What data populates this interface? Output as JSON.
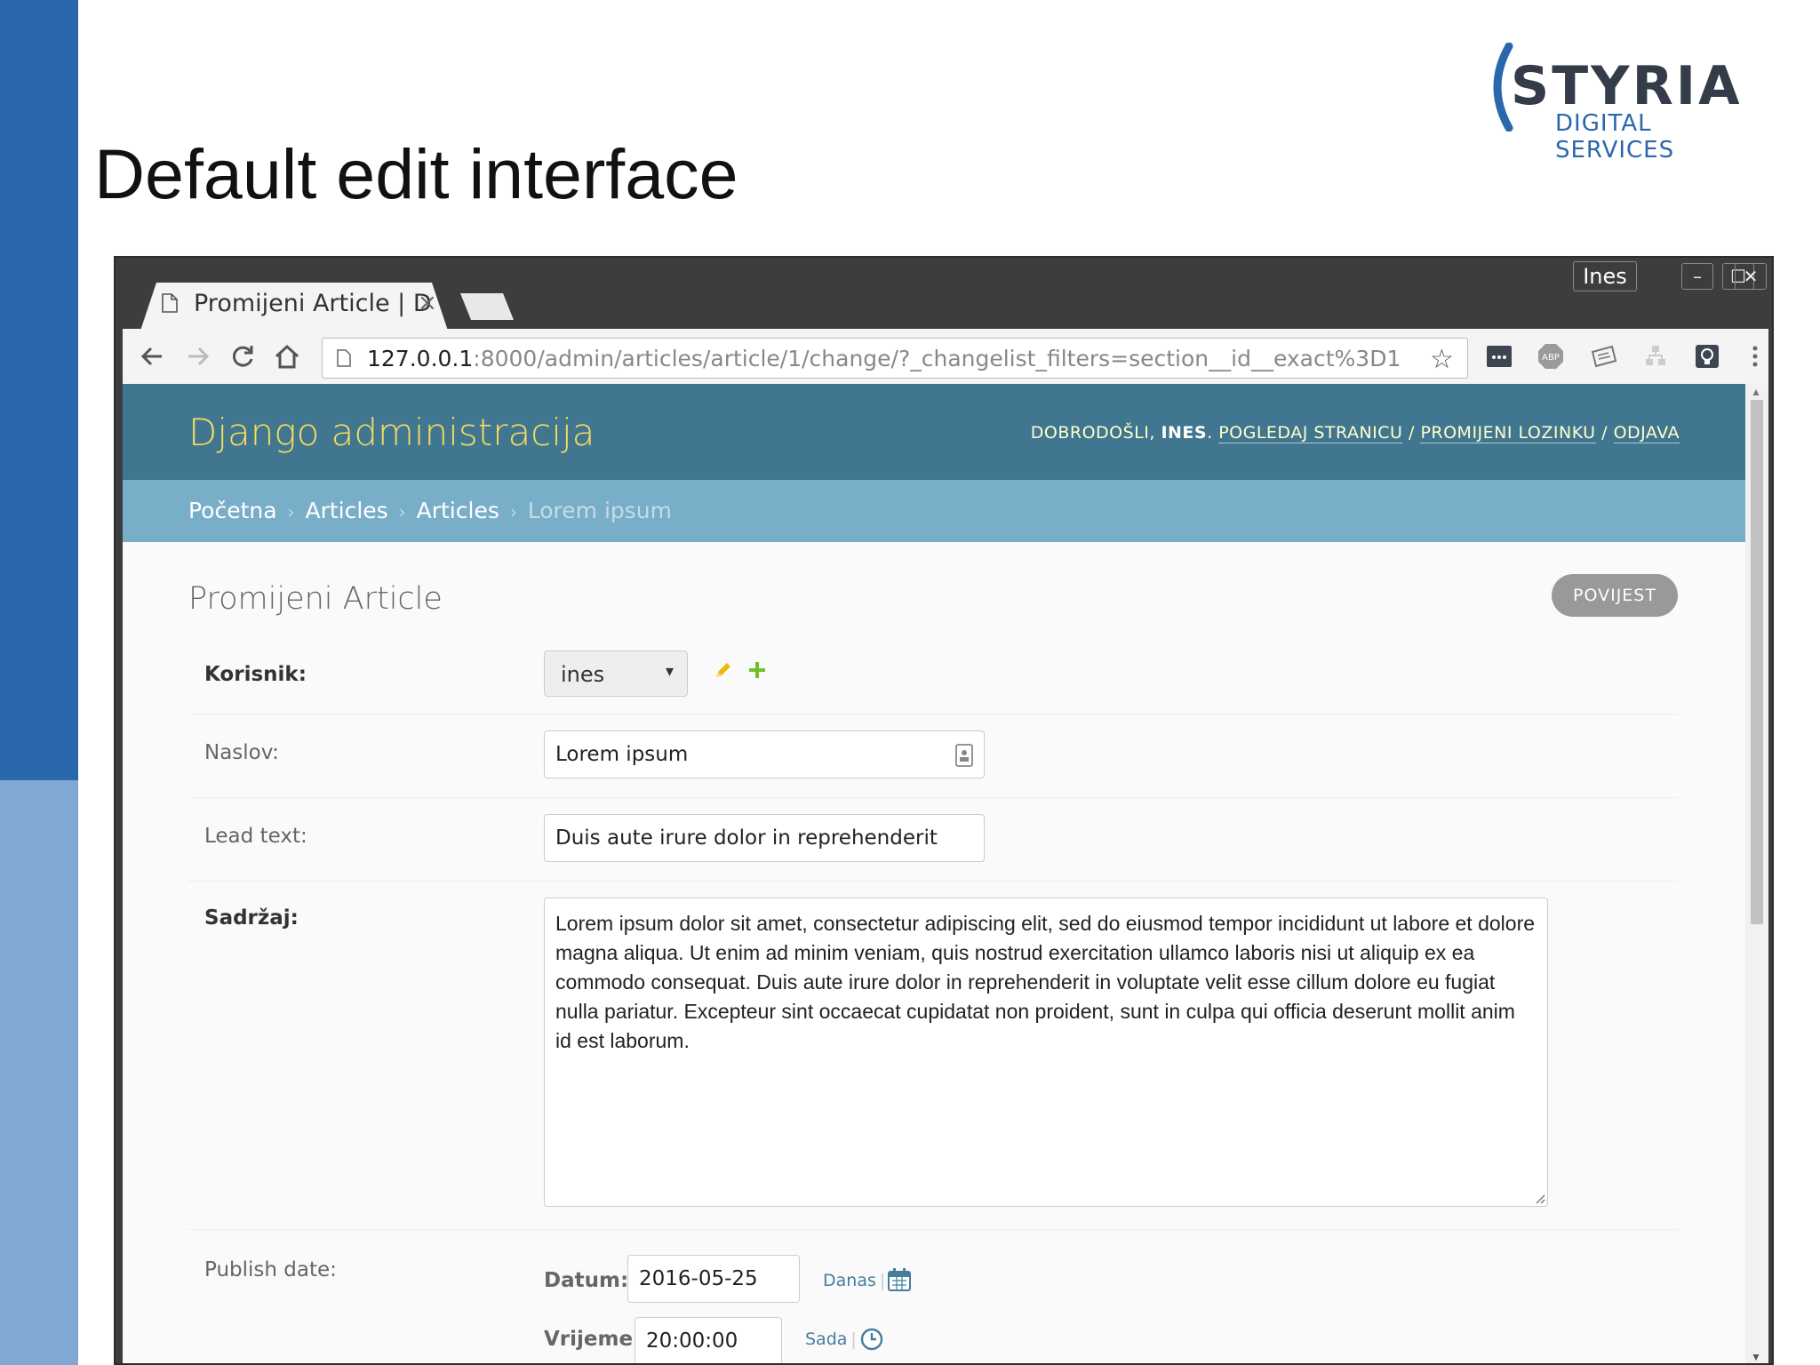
{
  "slide": {
    "title": "Default edit interface",
    "logo_word": "STYRIA",
    "logo_sub": "DIGITAL SERVICES"
  },
  "browser": {
    "tab_title": "Promijeni Article | D",
    "tab_close": "×",
    "user_chip": "Ines",
    "window_controls": {
      "minimize": "–",
      "maximize": "☐",
      "close": "✕"
    },
    "url_host": "127.0.0.1",
    "url_rest": ":8000/admin/articles/article/1/change/?_changelist_filters=section__id__exact%3D1",
    "bookmark_star": "☆"
  },
  "admin": {
    "branding": "Django administracija",
    "user_tools": {
      "welcome": "DOBRODOŠLI,",
      "username": "INES",
      "view_site": "POGLEDAJ STRANICU",
      "change_password": "PROMIJENI LOZINKU",
      "logout": "ODJAVA",
      "separator": "/"
    },
    "breadcrumbs": {
      "home": "Početna",
      "app": "Articles",
      "model": "Articles",
      "current": "Lorem ipsum",
      "separator": "›"
    },
    "content_title": "Promijeni Article",
    "history_button": "POVIJEST",
    "form": {
      "user": {
        "label": "Korisnik:",
        "value": "ines",
        "arrow": "▾"
      },
      "title": {
        "label": "Naslov:",
        "value": "Lorem ipsum"
      },
      "lead": {
        "label": "Lead text:",
        "value": "Duis aute irure dolor in reprehenderit"
      },
      "content": {
        "label": "Sadržaj:",
        "value": "Lorem ipsum dolor sit amet, consectetur adipiscing elit, sed do eiusmod tempor incididunt ut labore et dolore magna aliqua. Ut enim ad minim veniam, quis nostrud exercitation ullamco laboris nisi ut aliquip ex ea commodo consequat. Duis aute irure dolor in reprehenderit in voluptate velit esse cillum dolore eu fugiat nulla pariatur. Excepteur sint occaecat cupidatat non proident, sunt in culpa qui officia deserunt mollit anim id est laborum."
      },
      "publish": {
        "label": "Publish date:",
        "date_label": "Datum:",
        "date_value": "2016-05-25",
        "today": "Danas",
        "time_label": "Vrijeme:",
        "time_value": "20:00:00",
        "now": "Sada"
      }
    }
  },
  "colors": {
    "header": "#417690",
    "breadcrumbs": "#79aec8",
    "branding": "#f5dd5d",
    "slide_bar": "#2a67ad",
    "slide_bar_light": "#81a7d3"
  },
  "icons": [
    "document-icon",
    "back-arrow-icon",
    "forward-arrow-icon",
    "reload-icon",
    "home-icon",
    "star-icon",
    "extension-icon",
    "abp-icon",
    "pencil-icon",
    "plus-icon",
    "calendar-icon",
    "clock-icon"
  ]
}
